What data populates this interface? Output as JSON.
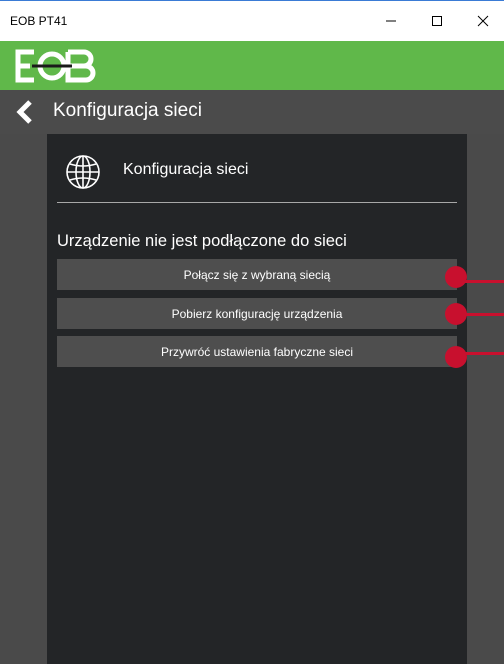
{
  "window": {
    "title": "EOB PT41"
  },
  "brand": {
    "logo_text": "EOB",
    "color": "#60b84a"
  },
  "nav": {
    "title": "Konfiguracja sieci",
    "back_icon": "chevron-left-icon"
  },
  "panel": {
    "icon": "globe-icon",
    "title": "Konfiguracja sieci",
    "status": "Urządzenie nie jest podłączone do sieci"
  },
  "actions": [
    {
      "label": "Połącz się z wybraną siecią"
    },
    {
      "label": "Pobierz konfigurację urządzenia"
    },
    {
      "label": "Przywróć ustawienia fabryczne sieci"
    }
  ],
  "colors": {
    "accent_marker": "#c8102e",
    "panel_bg": "#232527",
    "button_bg": "#4e4e4e"
  }
}
